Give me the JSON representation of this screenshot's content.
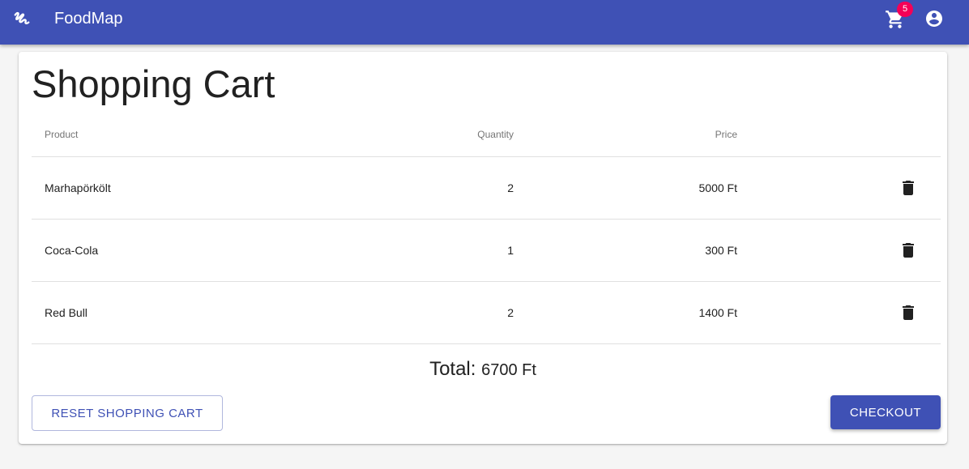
{
  "appbar": {
    "title": "FoodMap",
    "cart_count": "5",
    "color": "#3f51b5",
    "badge_color": "#f50057",
    "icons": [
      "logo-icon",
      "cart-icon",
      "account-circle-icon"
    ]
  },
  "page": {
    "title": "Shopping Cart"
  },
  "table": {
    "headers": {
      "product": "Product",
      "quantity": "Quantity",
      "price": "Price"
    },
    "rows": [
      {
        "product": "Marhapörkölt",
        "quantity": "2",
        "price": "5000 Ft"
      },
      {
        "product": "Coca-Cola",
        "quantity": "1",
        "price": "300 Ft"
      },
      {
        "product": "Red Bull",
        "quantity": "2",
        "price": "1400 Ft"
      }
    ]
  },
  "total": {
    "label": "Total:",
    "amount": "6700 Ft"
  },
  "actions": {
    "reset_label": "Reset Shopping Cart",
    "checkout_label": "Checkout"
  }
}
